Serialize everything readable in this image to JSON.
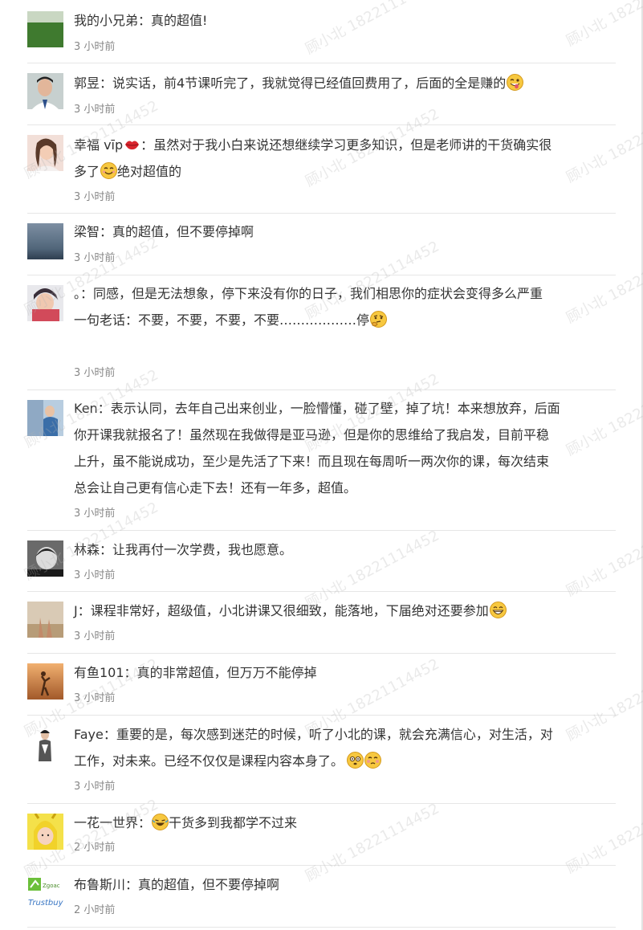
{
  "watermark_text": "顾小北 18221114452",
  "comments": [
    {
      "name": "我的小兄弟",
      "lines": [
        "真的超值!"
      ],
      "time": "3 小时前",
      "emoji": []
    },
    {
      "name": "郭昱",
      "lines": [
        "说实话，前4节课听完了，我就觉得已经值回费用了，后面的全是赚的"
      ],
      "time": "3 小时前",
      "emoji": [
        "wink-tongue"
      ]
    },
    {
      "name": "幸福 vīp",
      "name_emoji": "lips",
      "lines": [
        "虽然对于我小白来说还想继续学习更多知识，但是老师讲的干货确实很",
        "多了"
      ],
      "line2_tail": "绝对超值的",
      "time": "3 小时前",
      "emoji": [
        "smile"
      ]
    },
    {
      "name": "梁智",
      "lines": [
        "真的超值，但不要停掉啊"
      ],
      "time": "3 小时前",
      "emoji": []
    },
    {
      "name": "。",
      "lines": [
        "同感，但是无法想象，停下来没有你的日子，我们相思你的症状会变得多么严重",
        "",
        "一句老话：不要，不要，不要，不要………………停"
      ],
      "time": "3 小时前",
      "emoji": [
        "thinking"
      ]
    },
    {
      "name": "Ken",
      "lines": [
        "表示认同，去年自己出来创业，一脸懵懂，碰了壁，掉了坑！本来想放弃，后面",
        "你开课我就报名了！虽然现在我做得是亚马逊，但是你的思维给了我启发，目前平稳",
        "上升，虽不能说成功，至少是先活了下来！而且现在每周听一两次你的课，每次结束",
        "总会让自己更有信心走下去！还有一年多，超值。"
      ],
      "time": "3 小时前",
      "emoji": []
    },
    {
      "name": "林森",
      "lines": [
        "让我再付一次学费，我也愿意。"
      ],
      "time": "3 小时前",
      "emoji": []
    },
    {
      "name": "J",
      "lines": [
        "课程非常好，超级值，小北讲课又很细致，能落地，下届绝对还要参加"
      ],
      "time": "3 小时前",
      "emoji": [
        "grin"
      ]
    },
    {
      "name": "有鱼101",
      "lines": [
        "真的非常超值，但万万不能停掉"
      ],
      "time": "3 小时前",
      "emoji": []
    },
    {
      "name": "Faye",
      "lines": [
        "重要的是，每次感到迷茫的时候，听了小北的课，就会充满信心，对生活，对",
        "工作，对未来。已经不仅仅是课程内容本身了。"
      ],
      "time": "3 小时前",
      "emoji": [
        "flushed",
        "flushed-blush"
      ]
    },
    {
      "name": "一花一世界",
      "lines": [
        "干货多到我都学不过来"
      ],
      "time": "2 小时前",
      "emoji": [
        "laugh-cry"
      ]
    },
    {
      "name": "布鲁斯川",
      "lines": [
        "真的超值，但不要停掉啊"
      ],
      "time": "2 小时前",
      "emoji": [],
      "avatar_text": [
        "Zgoac",
        "Trustbuy"
      ]
    }
  ],
  "colors": {
    "text": "#333333",
    "time": "#888888",
    "separator": "#e6e6e6"
  }
}
